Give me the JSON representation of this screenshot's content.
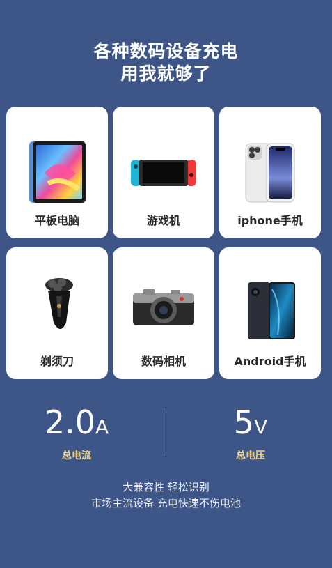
{
  "headline": {
    "line1": "各种数码设备充电",
    "line2": "用我就够了"
  },
  "devices": [
    {
      "label": "平板电脑",
      "icon": "tablet-icon"
    },
    {
      "label": "游戏机",
      "icon": "game-console-icon"
    },
    {
      "label": "iphone手机",
      "icon": "iphone-icon"
    },
    {
      "label": "剃须刀",
      "icon": "shaver-icon"
    },
    {
      "label": "数码相机",
      "icon": "camera-icon"
    },
    {
      "label": "Android手机",
      "icon": "android-phone-icon"
    }
  ],
  "stats": {
    "current": {
      "value": "2.0",
      "unit": "A",
      "caption": "总电流"
    },
    "voltage": {
      "value": "5",
      "unit": "V",
      "caption": "总电压"
    }
  },
  "tagline": {
    "line1": "大兼容性 轻松识别",
    "line2": "市场主流设备 充电快速不伤电池"
  },
  "colors": {
    "background": "#3d5687",
    "card": "#ffffff",
    "caption": "#f2d68d"
  }
}
